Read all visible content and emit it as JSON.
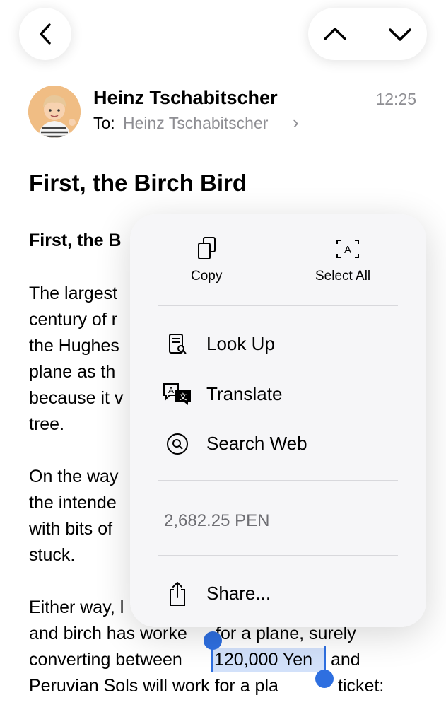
{
  "nav": {
    "back_icon": "chevron-left-icon",
    "prev_icon": "chevron-up-icon",
    "next_icon": "chevron-down-icon"
  },
  "header": {
    "sender": "Heinz Tschabitscher",
    "time": "12:25",
    "to_label": "To:",
    "to_name": "Heinz Tschabitscher",
    "to_chevron": "›"
  },
  "email": {
    "subject": "First, the Birch Bird",
    "heading": "First, the B",
    "lines": [
      "The largest",
      "century of r",
      "the Hughes",
      "plane as th",
      "because it v",
      "tree.",
      "On the way",
      "the intende",
      "with bits of",
      "stuck.",
      "Either way, l",
      "and birch has worke",
      "for a plane, surely",
      "converting between",
      "120,000 Yen",
      "and",
      "Peruvian Sols will work for a pla",
      "ticket:"
    ]
  },
  "menu": {
    "copy": "Copy",
    "select_all": "Select All",
    "look_up": "Look Up",
    "translate": "Translate",
    "search_web": "Search Web",
    "conversion": "2,682.25 PEN",
    "share": "Share..."
  },
  "colors": {
    "selection": "#2e6fe0",
    "secondary_text": "#8e8e93"
  }
}
